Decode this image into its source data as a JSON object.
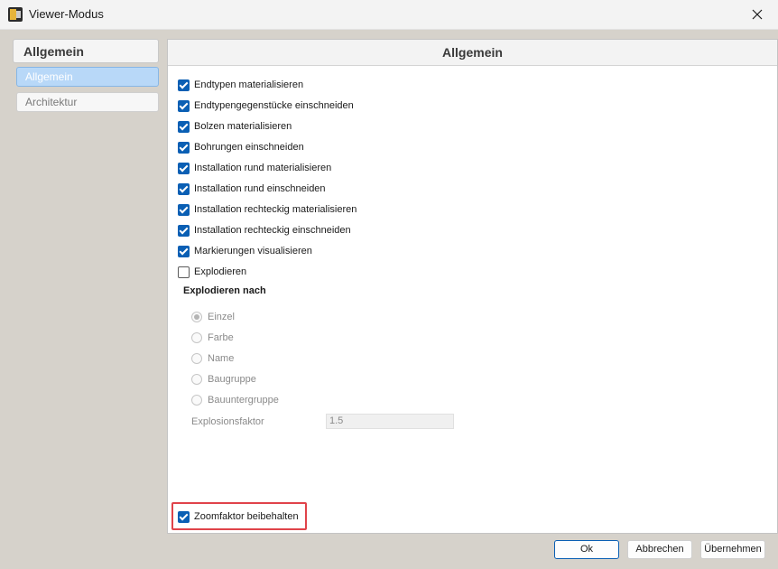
{
  "window": {
    "title": "Viewer-Modus",
    "icon": "app-logo-icon",
    "close_icon": "close-icon"
  },
  "sidebar": {
    "header": "Allgemein",
    "items": [
      {
        "label": "Allgemein",
        "selected": true
      },
      {
        "label": "Architektur",
        "selected": false
      }
    ]
  },
  "main": {
    "header": "Allgemein",
    "checkboxes": [
      {
        "label": "Endtypen materialisieren",
        "checked": true
      },
      {
        "label": "Endtypengegenstücke einschneiden",
        "checked": true
      },
      {
        "label": "Bolzen materialisieren",
        "checked": true
      },
      {
        "label": "Bohrungen einschneiden",
        "checked": true
      },
      {
        "label": "Installation rund materialisieren",
        "checked": true
      },
      {
        "label": "Installation rund einschneiden",
        "checked": true
      },
      {
        "label": "Installation rechteckig materialisieren",
        "checked": true
      },
      {
        "label": "Installation rechteckig einschneiden",
        "checked": true
      },
      {
        "label": "Markierungen visualisieren",
        "checked": true
      },
      {
        "label": "Explodieren",
        "checked": false
      }
    ],
    "explode_group": {
      "title": "Explodieren nach",
      "options": [
        {
          "label": "Einzel",
          "selected": true
        },
        {
          "label": "Farbe",
          "selected": false
        },
        {
          "label": "Name",
          "selected": false
        },
        {
          "label": "Baugruppe",
          "selected": false
        },
        {
          "label": "Bauuntergruppe",
          "selected": false
        }
      ],
      "factor_label": "Explosionsfaktor",
      "factor_value": "1.5"
    },
    "zoom_checkbox": {
      "label": "Zoomfaktor beibehalten",
      "checked": true
    }
  },
  "buttons": {
    "ok": "Ok",
    "cancel": "Abbrechen",
    "apply": "Übernehmen"
  },
  "colors": {
    "checkbox_accent": "#0a5fb4",
    "highlight": "#e0434a",
    "nav_selected": "#b8d8f8"
  }
}
